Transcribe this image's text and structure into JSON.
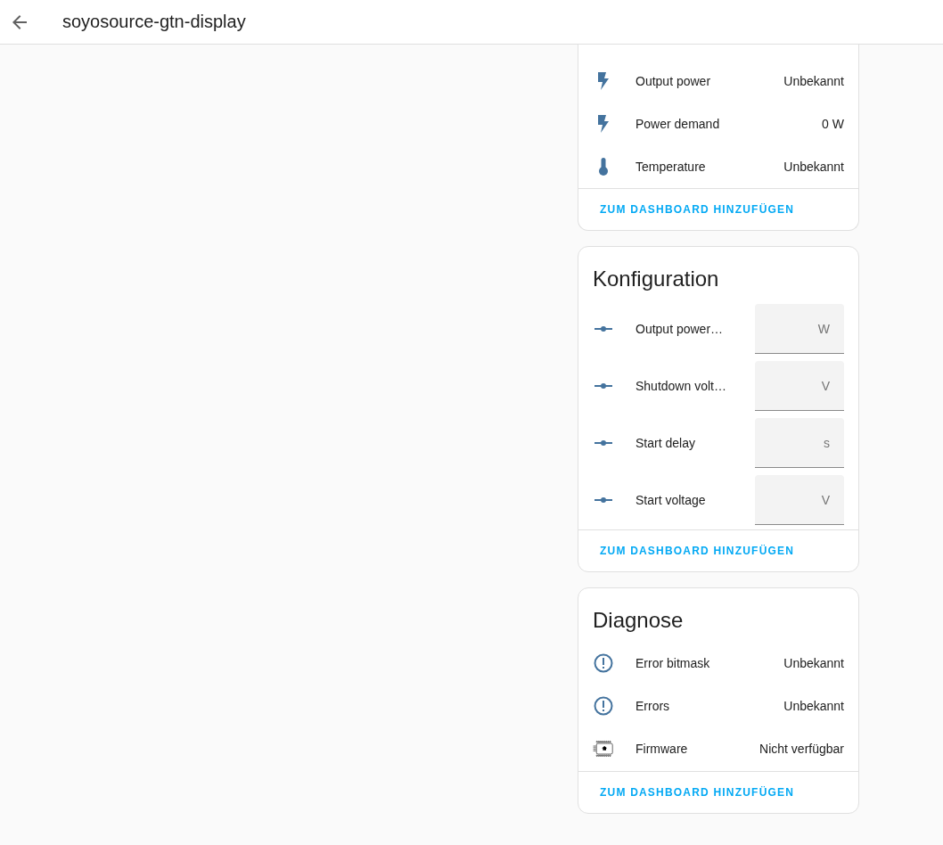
{
  "header": {
    "title": "soyosource-gtn-display"
  },
  "cards": [
    {
      "rows": [
        {
          "kind": "power",
          "name": "Output power",
          "value": "Unbekannt"
        },
        {
          "kind": "power",
          "name": "Power demand",
          "value": "0 W"
        },
        {
          "kind": "temperature",
          "name": "Temperature",
          "value": "Unbekannt"
        }
      ],
      "action": "ZUM DASHBOARD HINZUFÜGEN"
    },
    {
      "title": "Konfiguration",
      "rows": [
        {
          "kind": "number",
          "name": "Output power…",
          "unit": "W"
        },
        {
          "kind": "number",
          "name": "Shutdown volt…",
          "unit": "V"
        },
        {
          "kind": "number",
          "name": "Start delay",
          "unit": "s"
        },
        {
          "kind": "number",
          "name": "Start voltage",
          "unit": "V"
        }
      ],
      "action": "ZUM DASHBOARD HINZUFÜGEN"
    },
    {
      "title": "Diagnose",
      "rows": [
        {
          "kind": "problem",
          "name": "Error bitmask",
          "value": "Unbekannt"
        },
        {
          "kind": "problem",
          "name": "Errors",
          "value": "Unbekannt"
        },
        {
          "kind": "firmware",
          "name": "Firmware",
          "value": "Nicht verfügbar"
        }
      ],
      "action": "ZUM DASHBOARD HINZUFÜGEN"
    }
  ]
}
